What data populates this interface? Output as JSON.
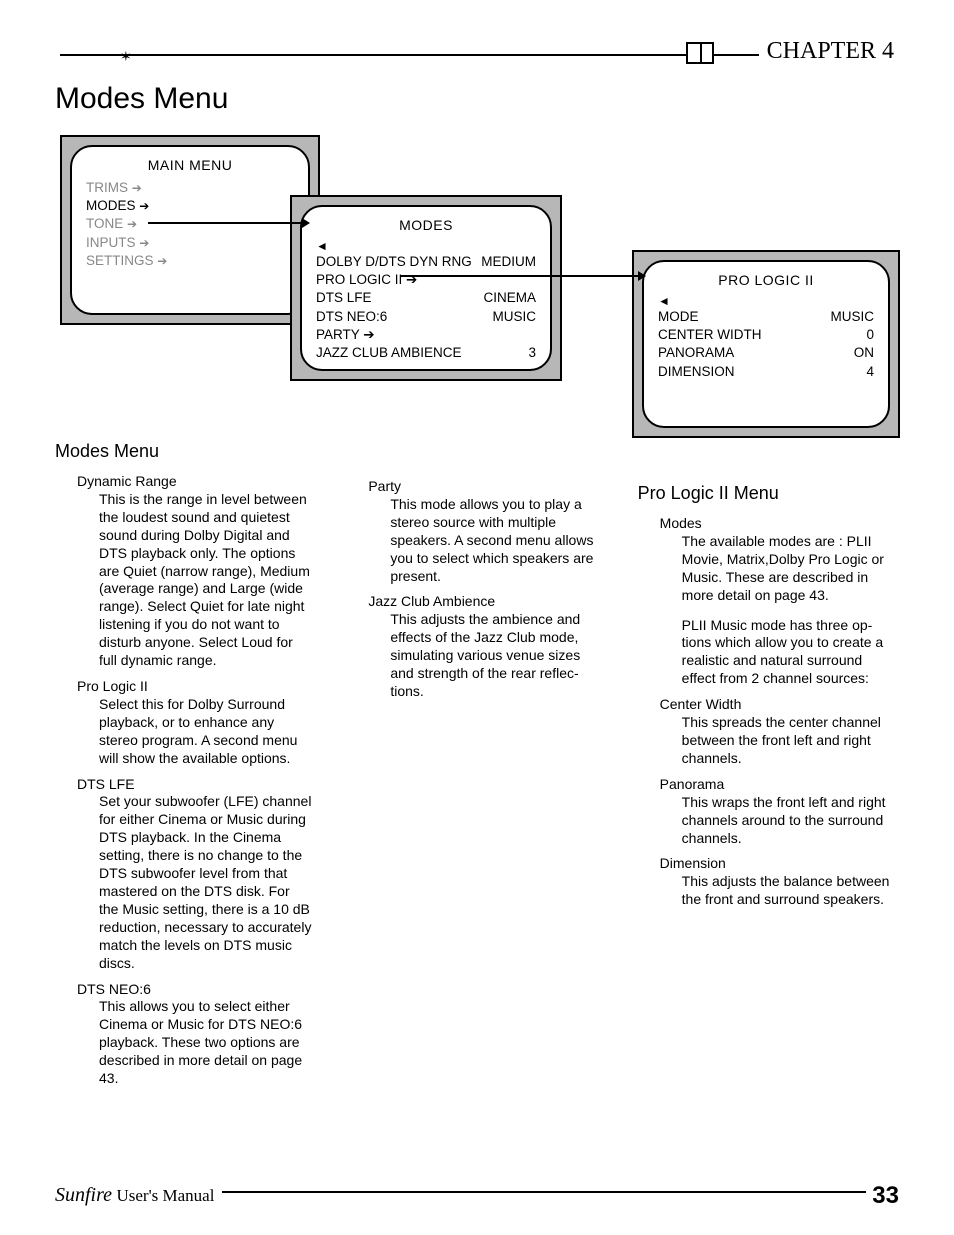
{
  "chapter": "CHAPTER 4",
  "title": "Modes Menu",
  "panel1": {
    "title": "MAIN MENU",
    "items": [
      {
        "label": "TRIMS",
        "arrow": true,
        "grey": true
      },
      {
        "label": "MODES",
        "arrow": true,
        "grey": false
      },
      {
        "label": "TONE",
        "arrow": true,
        "grey": true
      },
      {
        "label": "INPUTS",
        "arrow": true,
        "grey": true
      },
      {
        "label": "SETTINGS",
        "arrow": true,
        "grey": true
      }
    ]
  },
  "panel2": {
    "title": "MODES",
    "rows": [
      {
        "l": "DOLBY D/DTS DYN RNG",
        "r": "MEDIUM"
      },
      {
        "l": "PRO LOGIC II ➔",
        "r": ""
      },
      {
        "l": "DTS LFE",
        "r": "CINEMA"
      },
      {
        "l": "DTS NEO:6",
        "r": "MUSIC"
      },
      {
        "l": "PARTY ➔",
        "r": ""
      },
      {
        "l": "JAZZ CLUB AMBIENCE",
        "r": "3"
      }
    ]
  },
  "panel3": {
    "title": "PRO LOGIC II",
    "rows": [
      {
        "l": "MODE",
        "r": "MUSIC"
      },
      {
        "l": "CENTER WIDTH",
        "r": "0"
      },
      {
        "l": "PANORAMA",
        "r": "ON"
      },
      {
        "l": "DIMENSION",
        "r": "4"
      }
    ]
  },
  "col1": {
    "heading": "Modes Menu",
    "sections": [
      {
        "t": "Dynamic Range",
        "d": "This is the range in level be­tween the loudest sound and quietest sound during Dolby Digital and DTS playback only. The options are Quiet (nar­row range), Medium (average range) and Large (wide range). Select Quiet for late night listen­ing if you do not want to disturb anyone. Select Loud for full dynamic range."
      },
      {
        "t": "Pro Logic II",
        "d": "Select this for Dolby Surround playback, or to enhance any stereo program. A second menu will show the available options."
      },
      {
        "t": "DTS LFE",
        "d": "Set your subwoofer (LFE) channel for either Cinema or Music during DTS playback. In the Cinema setting, there is no change to the DTS subwoofer level from that mastered on the DTS disk. For the Music set­ting, there is a 10 dB reduction, necessary to accurately match the levels on DTS music discs."
      },
      {
        "t": "DTS NEO:6",
        "d": " This allows you to select either Cinema or Music for DTS NEO:6 playback. These two options are described in more detail on page 43."
      }
    ]
  },
  "col2": {
    "sections": [
      {
        "t": "Party",
        "d": "This mode allows you to play a stereo source with multiple speakers. A second menu al­lows you to select which speak­ers are present."
      },
      {
        "t": "Jazz Club Ambience",
        "d": "This adjusts the ambience and effects of the Jazz Club mode, simulating various venue sizes and strength of the rear reflec­tions."
      }
    ]
  },
  "col3": {
    "heading": "Pro Logic II Menu",
    "sections": [
      {
        "t": "Modes",
        "d": "The available modes are : PLII Movie, Matrix,Dolby Pro Logic or Music. These are de­scribed in more detail on page 43."
      },
      {
        "t": "",
        "d": "PLII Music mode has three op­tions which allow you to create a realistic and natural surround effect from 2 channel sources:"
      },
      {
        "t": "Center Width",
        "d": "This spreads the center chan­nel between the front left and right channels."
      },
      {
        "t": "Panorama",
        "d": "This wraps the front left and right channels around to the surround channels."
      },
      {
        "t": "Dimension",
        "d": "This adjusts the balance be­tween the front and surround speakers."
      }
    ]
  },
  "footer": {
    "brand": "Sunfire",
    "manual": "User's Manual",
    "page": "33"
  }
}
